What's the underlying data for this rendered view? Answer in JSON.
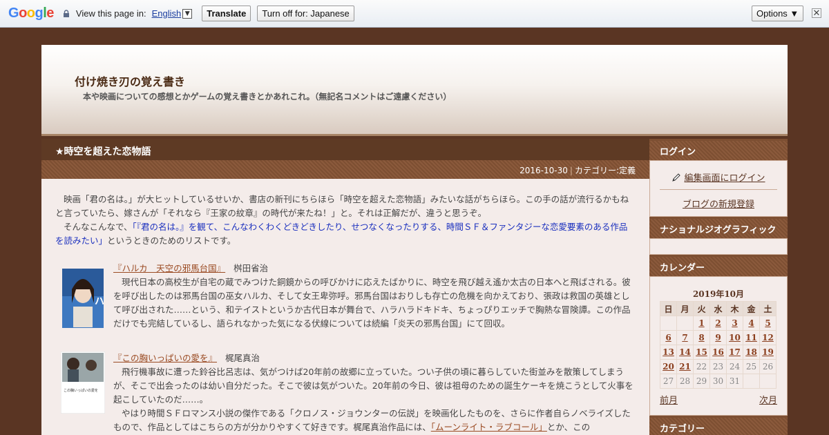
{
  "translate_bar": {
    "logo_letters": [
      {
        "ch": "G",
        "color": "#4285f4"
      },
      {
        "ch": "o",
        "color": "#ea4335"
      },
      {
        "ch": "o",
        "color": "#fbbc05"
      },
      {
        "ch": "g",
        "color": "#4285f4"
      },
      {
        "ch": "l",
        "color": "#34a853"
      },
      {
        "ch": "e",
        "color": "#ea4335"
      }
    ],
    "view_text": "View this page in:",
    "language": "English",
    "translate_label": "Translate",
    "turn_off_label": "Turn off for: Japanese",
    "options_label": "Options ▼",
    "close_label": "✕"
  },
  "header": {
    "title": "付け焼き刃の覚え書き",
    "description": "本や映画についての感想とかゲームの覚え書きとかあれこれ。（無記名コメントはご遠慮ください）"
  },
  "post": {
    "title": "★時空を超えた恋物語",
    "date": "2016-10-30",
    "separator": "|",
    "category": "カテゴリー:定義",
    "intro1": "映画「君の名は。」が大ヒットしているせいか、書店の新刊にちらほら「時空を超えた恋物語」みたいな話がちらほら。この手の話が流行るかもねと言っていたら、嫁さんが「それなら『王家の紋章』の時代が来たね！」と。それは正解だが、違うと思うぞ。",
    "intro2_prefix": "そんなこんなで、",
    "intro2_blue": "「『君の名は。』を観て、こんなわくわくどきどきしたり、せつなくなったりする、時間ＳＦ＆ファンタジーな恋愛要素のある作品を読みたい」",
    "intro2_suffix": "というときのためのリストです。",
    "books": [
      {
        "title": "『ハルカ　天空の邪馬台国』",
        "author": "桝田省治",
        "text": "現代日本の高校生が自宅の蔵でみつけた銅鏡からの呼びかけに応えたばかりに、時空を飛び越え遙か太古の日本へと飛ばされる。彼を呼び出したのは邪馬台国の巫女ハルカ、そして女王卑弥呼。邪馬台国はおりしも存亡の危機を向かえており、張政は救国の英雄として呼び出された……という、和テイストというか古代日本が舞台で、ハラハラドキドキ、ちょっぴりエッチで胸熱な冒険譚。この作品だけでも完結しているし、語られなかった気になる伏線については続編「炎天の邪馬台国」にて回収。",
        "cover_text": "ハルカ"
      },
      {
        "title": "『この胸いっぱいの愛を』",
        "author": "梶尾真治",
        "text": "飛行機事故に遭った鈴谷比呂志は、気がつけば20年前の故郷に立っていた。つい子供の頃に暮らしていた街並みを散策してしまうが、そこで出会ったのは幼い自分だった。そこで彼は気がついた。20年前の今日、彼は祖母のための誕生ケーキを焼こうとして火事を起こしていたのだ……。",
        "text2_prefix": "やはり時間ＳＦロマンス小説の傑作である「クロノス・ジョウンターの伝説」を映画化したものを、さらに作者自らノベライズしたもので、作品としてはこちらの方が分かりやすくて好きです。梶尾真治作品には、",
        "text2_link": "「ムーンライト・ラブコール」",
        "text2_suffix": "とか、この",
        "cover_text": "この胸いっぱいの愛を"
      }
    ]
  },
  "sidebar": {
    "login_heading": "ログイン",
    "login_link": "編集画面にログイン",
    "register_link": "ブログの新規登録",
    "natgeo_heading": "ナショナルジオグラフィック",
    "calendar_heading": "カレンダー",
    "calendar_title": "2019年10月",
    "weekdays": [
      "日",
      "月",
      "火",
      "水",
      "木",
      "金",
      "土"
    ],
    "weeks": [
      [
        "",
        "",
        "1",
        "2",
        "3",
        "4",
        "5"
      ],
      [
        "6",
        "7",
        "8",
        "9",
        "10",
        "11",
        "12"
      ],
      [
        "13",
        "14",
        "15",
        "16",
        "17",
        "18",
        "19"
      ],
      [
        "20",
        "21",
        "22",
        "23",
        "24",
        "25",
        "26"
      ],
      [
        "27",
        "28",
        "29",
        "30",
        "31",
        "",
        ""
      ]
    ],
    "linked_days": [
      "1",
      "2",
      "3",
      "4",
      "5",
      "6",
      "7",
      "8",
      "9",
      "10",
      "11",
      "12",
      "13",
      "14",
      "15",
      "16",
      "17",
      "18",
      "19",
      "20",
      "21"
    ],
    "prev_month": "前月",
    "next_month": "次月",
    "category_heading": "カテゴリー"
  }
}
